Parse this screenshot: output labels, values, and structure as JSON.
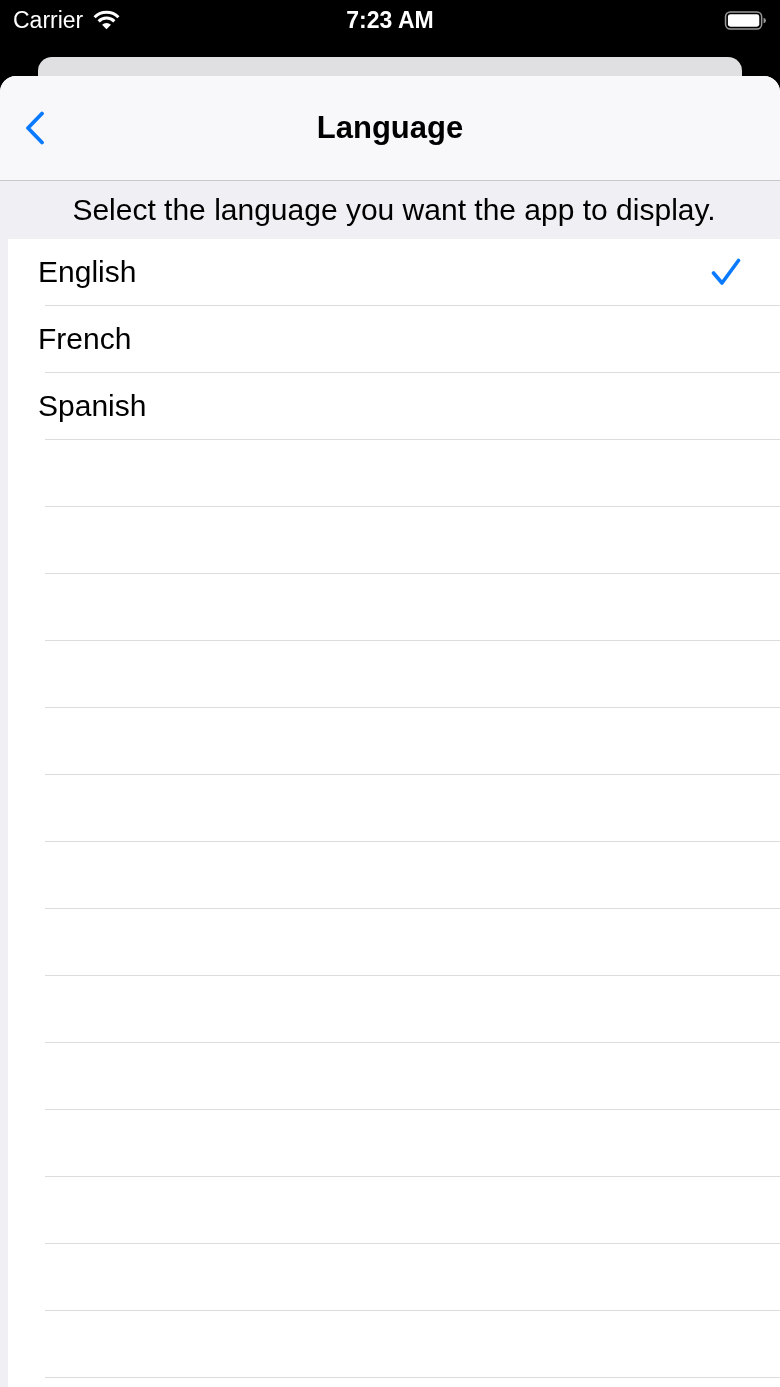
{
  "status_bar": {
    "carrier": "Carrier",
    "time": "7:23 AM"
  },
  "navigation_bar": {
    "title": "Language"
  },
  "header": "Select the language you want the app to display.",
  "languages": [
    {
      "label": "English",
      "selected": true
    },
    {
      "label": "French",
      "selected": false
    },
    {
      "label": "Spanish",
      "selected": false
    }
  ]
}
